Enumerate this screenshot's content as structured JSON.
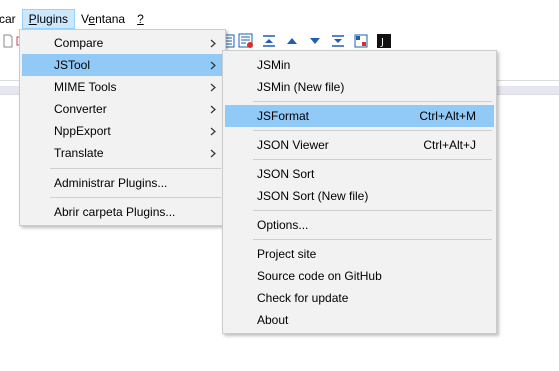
{
  "menubar": {
    "items": [
      {
        "label": "car",
        "underline": ""
      },
      {
        "label": "Plugins",
        "underline": "P"
      },
      {
        "label": "Ventana",
        "underline": "e"
      },
      {
        "label": "?",
        "underline": "?"
      }
    ]
  },
  "plugins_menu": {
    "items": [
      {
        "label": "Compare",
        "submenu": true
      },
      {
        "label": "JSTool",
        "submenu": true,
        "highlighted": true
      },
      {
        "label": "MIME Tools",
        "submenu": true
      },
      {
        "label": "Converter",
        "submenu": true
      },
      {
        "label": "NppExport",
        "submenu": true
      },
      {
        "label": "Translate",
        "submenu": true
      },
      {
        "label": "Administrar Plugins..."
      },
      {
        "label": "Abrir carpeta Plugins..."
      }
    ]
  },
  "jstool_menu": {
    "items": [
      {
        "label": "JSMin",
        "shortcut": ""
      },
      {
        "label": "JSMin (New file)",
        "shortcut": ""
      },
      {
        "label": "JSFormat",
        "shortcut": "Ctrl+Alt+M",
        "highlighted": true
      },
      {
        "label": "JSON Viewer",
        "shortcut": "Ctrl+Alt+J"
      },
      {
        "label": "JSON Sort",
        "shortcut": ""
      },
      {
        "label": "JSON Sort (New file)",
        "shortcut": ""
      },
      {
        "label": "Options...",
        "shortcut": ""
      },
      {
        "label": "Project site",
        "shortcut": ""
      },
      {
        "label": "Source code on GitHub",
        "shortcut": ""
      },
      {
        "label": "Check for update",
        "shortcut": ""
      },
      {
        "label": "About",
        "shortcut": ""
      }
    ]
  },
  "colors": {
    "highlight": "#91c9f7",
    "menu_bg": "#f2f2f2",
    "menubar_active": "#cce8ff"
  }
}
